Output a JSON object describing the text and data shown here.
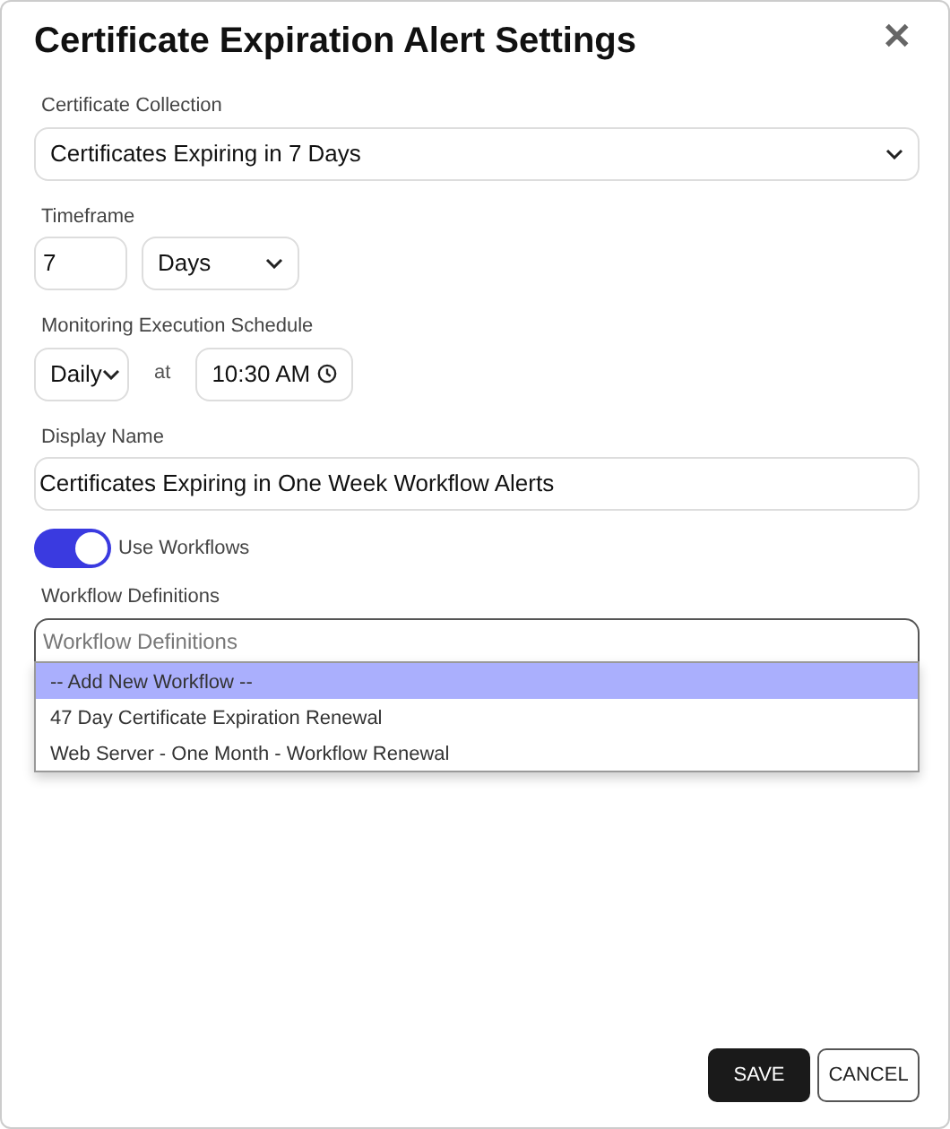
{
  "dialog": {
    "title": "Certificate Expiration Alert Settings",
    "close": "✕"
  },
  "collection": {
    "label": "Certificate Collection",
    "value": "Certificates Expiring in 7 Days"
  },
  "timeframe": {
    "label": "Timeframe",
    "amount": "7",
    "unit": "Days"
  },
  "schedule": {
    "label": "Monitoring Execution Schedule",
    "frequency": "Daily",
    "at": "at",
    "time": "10:30 AM"
  },
  "display_name": {
    "label": "Display Name",
    "value": "Certificates Expiring in One Week Workflow Alerts"
  },
  "use_workflows": {
    "label": "Use Workflows",
    "on": true
  },
  "workflow_definitions": {
    "label": "Workflow Definitions",
    "placeholder": "Workflow Definitions",
    "expanded": true,
    "options": [
      {
        "label": "-- Add New Workflow --",
        "selected": true
      },
      {
        "label": "47 Day Certificate Expiration Renewal",
        "selected": false
      },
      {
        "label": "Web Server - One Month - Workflow Renewal",
        "selected": false
      }
    ]
  },
  "buttons": [
    {
      "label": "SAVE",
      "kind": "primary"
    },
    {
      "label": "CANCEL",
      "kind": "secondary"
    }
  ]
}
